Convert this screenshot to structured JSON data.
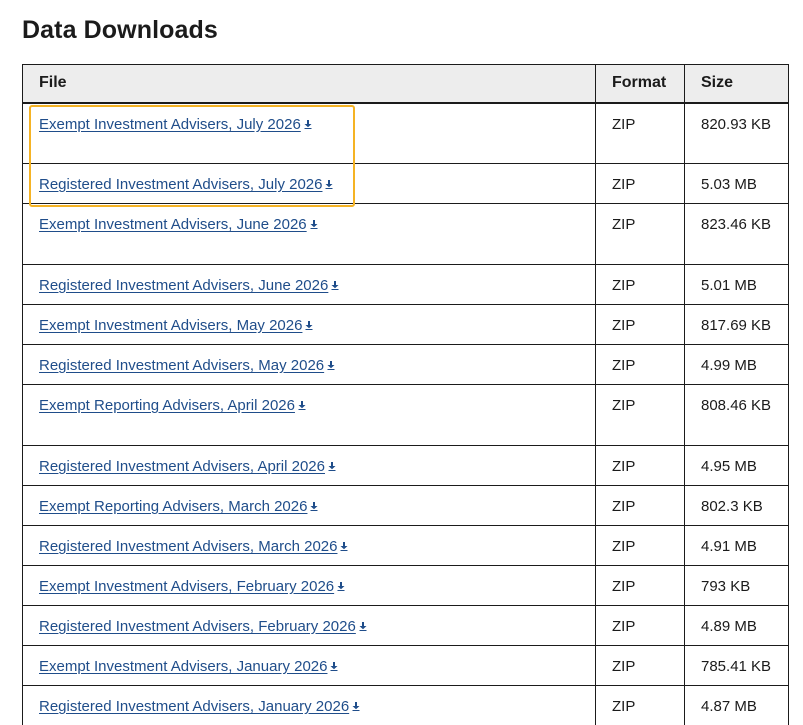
{
  "page": {
    "title": "Data Downloads"
  },
  "table": {
    "headers": {
      "file": "File",
      "format": "Format",
      "size": "Size"
    },
    "rows": [
      {
        "file": "Exempt Investment Advisers, July 2026",
        "format": "ZIP",
        "size": "820.93 KB",
        "tall": true
      },
      {
        "file": "Registered Investment Advisers, July 2026",
        "format": "ZIP",
        "size": "5.03 MB",
        "tall": false
      },
      {
        "file": "Exempt Investment Advisers, June 2026",
        "format": "ZIP",
        "size": "823.46 KB",
        "tall": true
      },
      {
        "file": "Registered Investment Advisers, June 2026",
        "format": "ZIP",
        "size": "5.01 MB",
        "tall": false
      },
      {
        "file": "Exempt Investment Advisers, May 2026",
        "format": "ZIP",
        "size": "817.69 KB",
        "tall": false
      },
      {
        "file": "Registered Investment Advisers, May 2026",
        "format": "ZIP",
        "size": "4.99 MB",
        "tall": false
      },
      {
        "file": "Exempt Reporting Advisers, April 2026",
        "format": "ZIP",
        "size": "808.46 KB",
        "tall": true
      },
      {
        "file": "Registered Investment Advisers, April 2026",
        "format": "ZIP",
        "size": "4.95 MB",
        "tall": false
      },
      {
        "file": "Exempt Reporting Advisers, March 2026",
        "format": "ZIP",
        "size": "802.3 KB",
        "tall": false
      },
      {
        "file": "Registered Investment Advisers, March 2026",
        "format": "ZIP",
        "size": "4.91 MB",
        "tall": false
      },
      {
        "file": "Exempt Investment Advisers, February 2026",
        "format": "ZIP",
        "size": "793 KB",
        "tall": false
      },
      {
        "file": "Registered Investment Advisers, February 2026",
        "format": "ZIP",
        "size": "4.89 MB",
        "tall": false
      },
      {
        "file": "Exempt Investment Advisers, January 2026",
        "format": "ZIP",
        "size": "785.41 KB",
        "tall": false
      },
      {
        "file": "Registered Investment Advisers, January 2026",
        "format": "ZIP",
        "size": "4.87 MB",
        "tall": false
      }
    ]
  },
  "icons": {
    "download": "download-icon"
  },
  "colors": {
    "link": "#1f4d8a",
    "header_bg": "#ededed",
    "highlight": "#f5b324",
    "text": "#1b1b1b"
  }
}
